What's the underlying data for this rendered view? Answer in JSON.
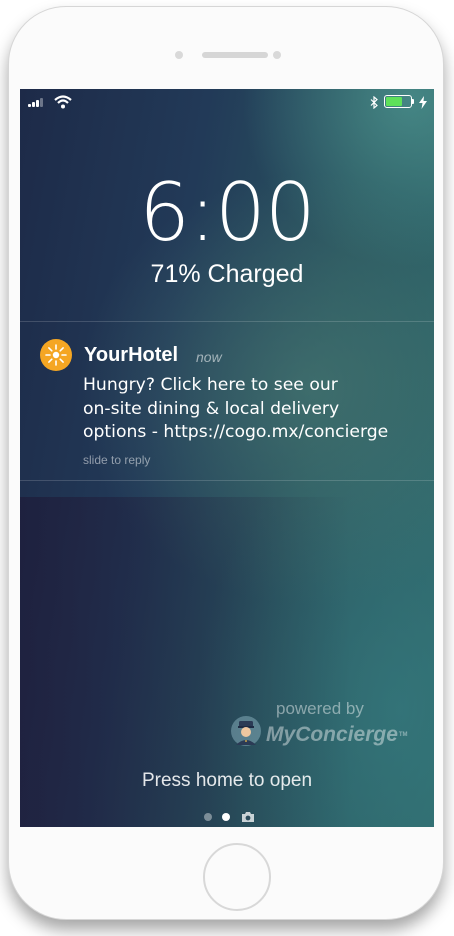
{
  "status_bar": {
    "signal": "signal-bars-icon",
    "wifi": "wifi-icon",
    "bluetooth": "bluetooth-icon",
    "battery_level": 0.71,
    "battery_color": "#5ee05a",
    "charging": "lightning-icon"
  },
  "lockscreen": {
    "time": "6:00",
    "charge_status": "71% Charged",
    "press_home": "Press home to open"
  },
  "notification": {
    "app_name": "YourHotel",
    "app_icon": "sunburst-icon",
    "app_icon_color": "#f5a623",
    "time": "now",
    "body_lines": [
      "Hungry? Click here to see our",
      "on-site dining & local delivery",
      "options - https://cogo.mx/concierge"
    ],
    "hint": "slide to reply"
  },
  "branding": {
    "powered_by": "powered by",
    "logo_my": "My",
    "logo_name": "Concierge",
    "logo_mark": "TM",
    "logo_icon": "bellhop-icon"
  },
  "pager": {
    "pages": 2,
    "active": 2,
    "camera": "camera-icon"
  }
}
